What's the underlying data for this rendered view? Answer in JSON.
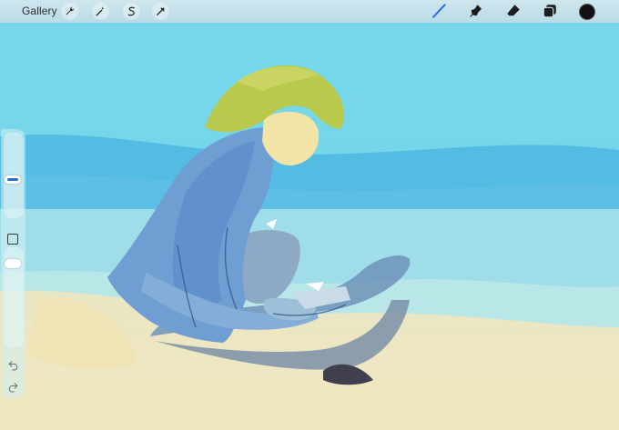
{
  "toolbar": {
    "gallery_label": "Gallery",
    "left_tools": [
      "wrench-icon",
      "magic-wand-icon",
      "selection-s-icon",
      "arrow-transform-icon"
    ],
    "right_tools": [
      "brush-icon",
      "smudge-icon",
      "eraser-icon",
      "layers-icon"
    ],
    "active_tool": "brush-icon",
    "current_color": "#111111",
    "accent_color": "#2f6bd8"
  },
  "sidebar": {
    "controls": [
      "brush-size-slider",
      "modify-button",
      "opacity-slider",
      "undo-icon",
      "redo-icon"
    ]
  }
}
